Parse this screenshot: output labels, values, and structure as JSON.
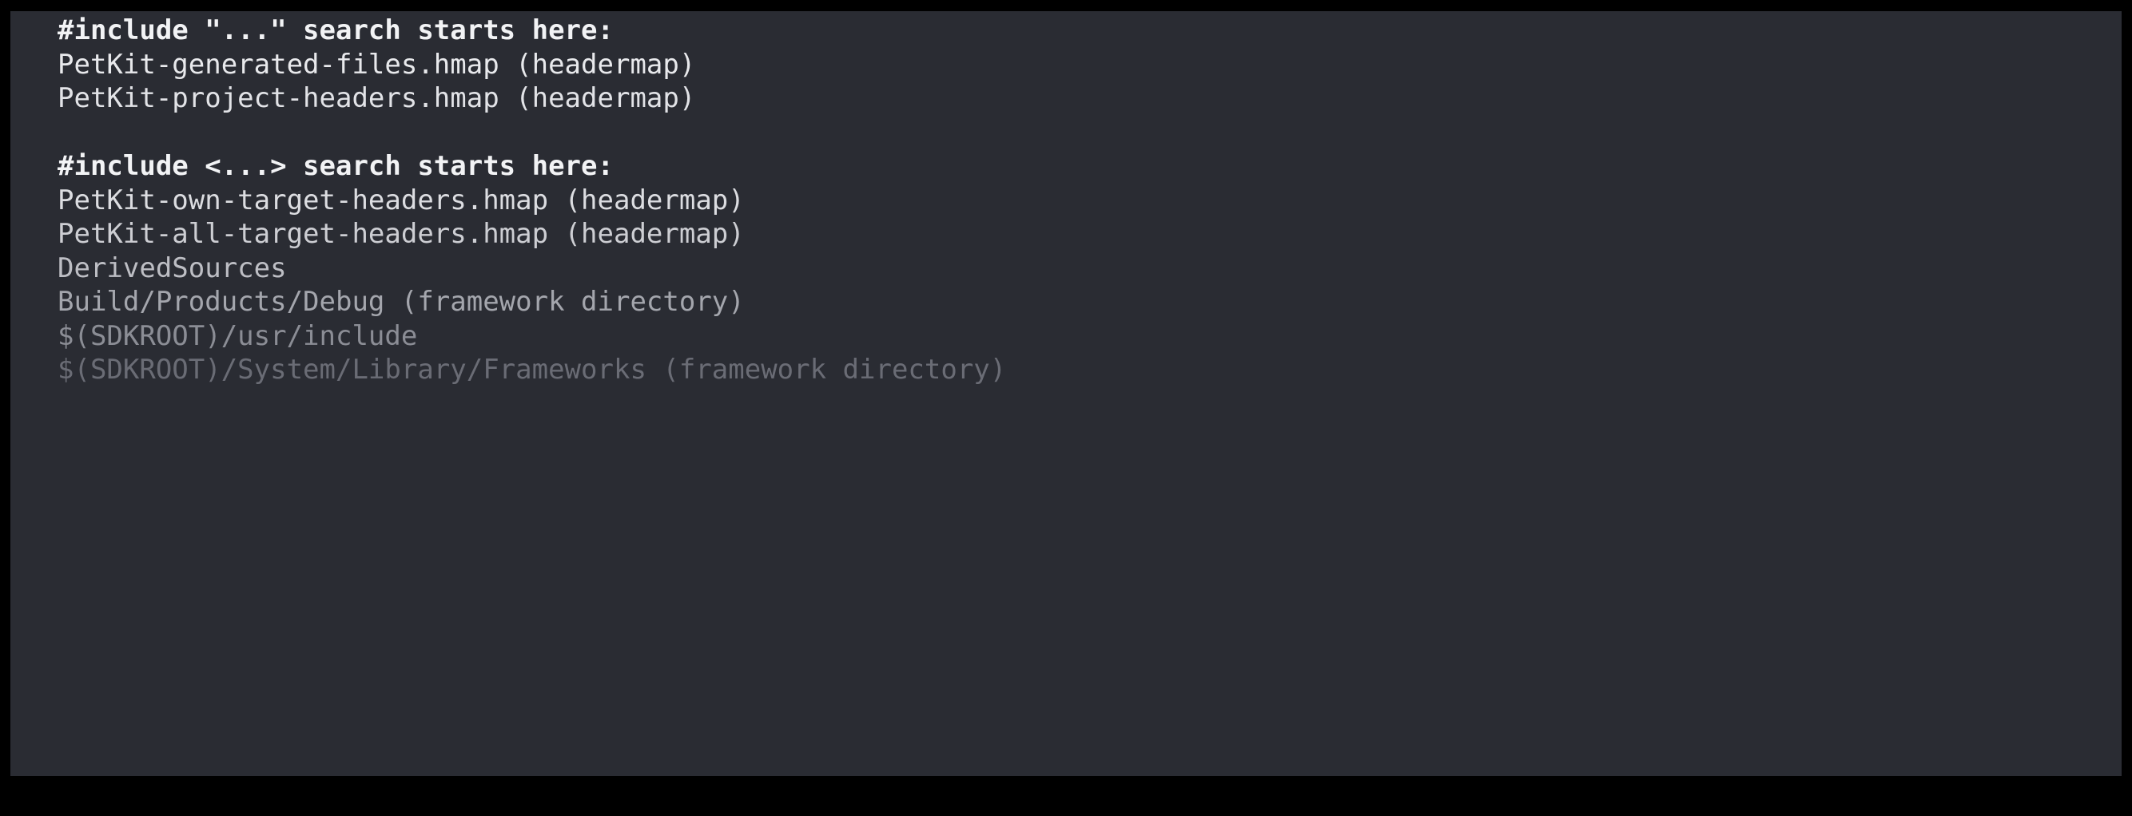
{
  "panel": {
    "type": "build-log-console",
    "background_color": "#2a2c33",
    "frame_color": "#000000"
  },
  "console": {
    "lines": [
      {
        "text": "#include \"...\" search starts here:",
        "role": "section-header",
        "weight": "bold",
        "color": "#f2f3f5"
      },
      {
        "text": "PetKit-generated-files.hmap (headermap)",
        "role": "search-path",
        "weight": "normal",
        "color": "#e8e9ec"
      },
      {
        "text": "PetKit-project-headers.hmap (headermap)",
        "role": "search-path",
        "weight": "normal",
        "color": "#e2e3e7"
      },
      {
        "text": "",
        "role": "blank-line",
        "weight": "normal",
        "color": "#2a2c33"
      },
      {
        "text": "#include <...> search starts here:",
        "role": "section-header",
        "weight": "bold",
        "color": "#f2f3f5"
      },
      {
        "text": "PetKit-own-target-headers.hmap (headermap)",
        "role": "search-path",
        "weight": "normal",
        "color": "#dcdde1"
      },
      {
        "text": "PetKit-all-target-headers.hmap (headermap)",
        "role": "search-path",
        "weight": "normal",
        "color": "#cdced3"
      },
      {
        "text": "DerivedSources",
        "role": "search-path",
        "weight": "normal",
        "color": "#bdbec4"
      },
      {
        "text": "Build/Products/Debug (framework directory)",
        "role": "search-path",
        "weight": "normal",
        "color": "#a4a6ad"
      },
      {
        "text": "$(SDKROOT)/usr/include",
        "role": "search-path",
        "weight": "normal",
        "color": "#8b8d95"
      },
      {
        "text": "$(SDKROOT)/System/Library/Frameworks (framework directory)",
        "role": "search-path",
        "weight": "normal",
        "color": "#6a6c75"
      }
    ]
  }
}
